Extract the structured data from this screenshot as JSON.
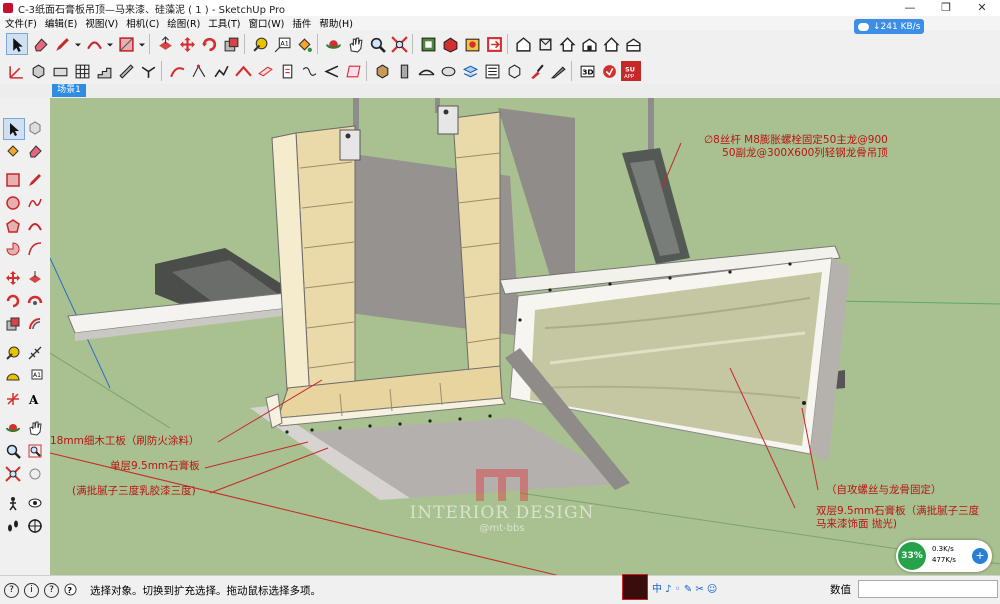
{
  "window": {
    "title": "C-3纸面石膏板吊顶—马来漆、硅藻泥 ( 1 ) - SketchUp Pro",
    "minimize": "—",
    "restore": "❐",
    "close": "✕"
  },
  "menu": [
    "文件(F)",
    "编辑(E)",
    "视图(V)",
    "相机(C)",
    "绘图(R)",
    "工具(T)",
    "窗口(W)",
    "插件",
    "帮助(H)"
  ],
  "network_badge": "↓241 KB/s",
  "scene_tab": "场景1",
  "viewport": {
    "background": "#a9c190",
    "annotations": [
      {
        "id": "rod",
        "lines": [
          "∅8丝杆 M8膨胀螺栓固定50主龙@900",
          "50副龙@300X600列轻钢龙骨吊顶"
        ]
      },
      {
        "id": "plywood",
        "lines": [
          "18mm细木工板（刷防火涂料）"
        ]
      },
      {
        "id": "single-board",
        "lines": [
          "单层9.5mm石膏板"
        ]
      },
      {
        "id": "paint",
        "lines": [
          "(满批腻子三度乳胶漆三度)"
        ]
      },
      {
        "id": "screw",
        "lines": [
          "（自攻螺丝与龙骨固定）"
        ]
      },
      {
        "id": "double-board",
        "lines": [
          "双层9.5mm石膏板（满批腻子三度",
          "马来漆饰面 抛光)"
        ]
      }
    ],
    "watermark": {
      "brand": "INTERIOR DESIGN",
      "handle": "@mt-bbs"
    }
  },
  "status": {
    "text": "选择对象。切换到扩充选择。拖动鼠标选择多项。",
    "measure_label": "数值",
    "icons": [
      "?",
      "i",
      "?"
    ]
  },
  "ime": "中 ♪ ◦ ✎ ✂ ☺",
  "net_widget": {
    "percent": "33%",
    "up": "0.3K/s",
    "down": "477K/s",
    "plus": "+"
  }
}
